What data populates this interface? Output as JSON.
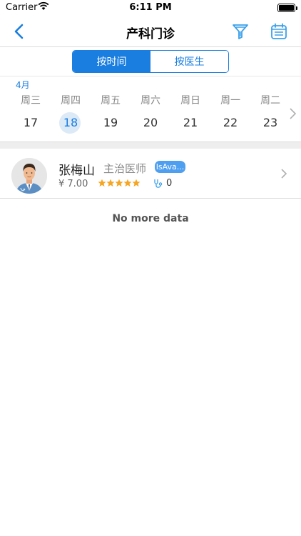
{
  "status_bar": {
    "carrier": "Carrier",
    "time": "6:11 PM"
  },
  "nav": {
    "title": "产科门诊",
    "icons": {
      "back": "chevron-left-icon",
      "filter": "filter-icon",
      "calendar": "calendar-icon"
    }
  },
  "segment": {
    "tabs": [
      {
        "label": "按时间",
        "active": true
      },
      {
        "label": "按医生",
        "active": false
      }
    ]
  },
  "calendar": {
    "month": "4月",
    "weekdays": [
      "周三",
      "周四",
      "周五",
      "周六",
      "周日",
      "周一",
      "周二"
    ],
    "days": [
      "17",
      "18",
      "19",
      "20",
      "21",
      "22",
      "23"
    ],
    "selected_day": "18"
  },
  "doctor": {
    "name": "张梅山",
    "title": "主治医师",
    "badge": "IsAva...",
    "price": "¥  7.00",
    "rating_stars": 5,
    "consult_count": "0"
  },
  "list_footer": "No more data",
  "colors": {
    "accent": "#1a7ee0",
    "badge": "#4f9ff0",
    "star": "#f5a623"
  }
}
